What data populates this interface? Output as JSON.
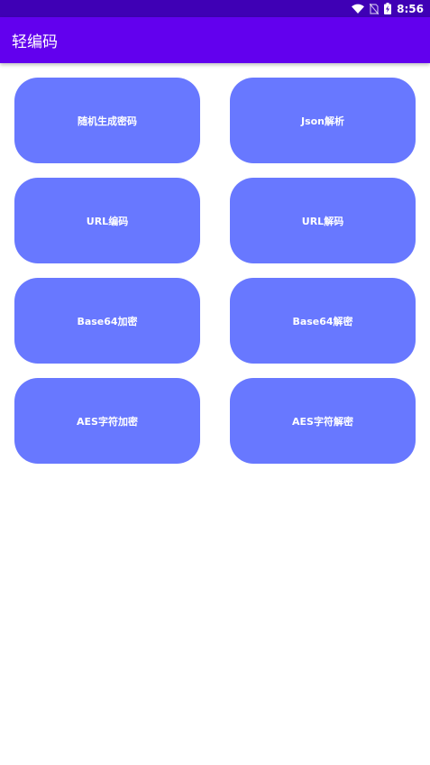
{
  "status_bar": {
    "time": "8:56",
    "icons": [
      "wifi-icon",
      "no-sim-icon",
      "battery-charging-icon"
    ]
  },
  "app_bar": {
    "title": "轻编码"
  },
  "buttons": [
    {
      "label": "随机生成密码"
    },
    {
      "label": "Json解析"
    },
    {
      "label": "URL编码"
    },
    {
      "label": "URL解码"
    },
    {
      "label": "Base64加密"
    },
    {
      "label": "Base64解密"
    },
    {
      "label": "AES字符加密"
    },
    {
      "label": "AES字符解密"
    }
  ],
  "colors": {
    "status_bar": "#3f00b5",
    "app_bar": "#6200ee",
    "button": "#6878ff",
    "text_on_color": "#ffffff"
  }
}
